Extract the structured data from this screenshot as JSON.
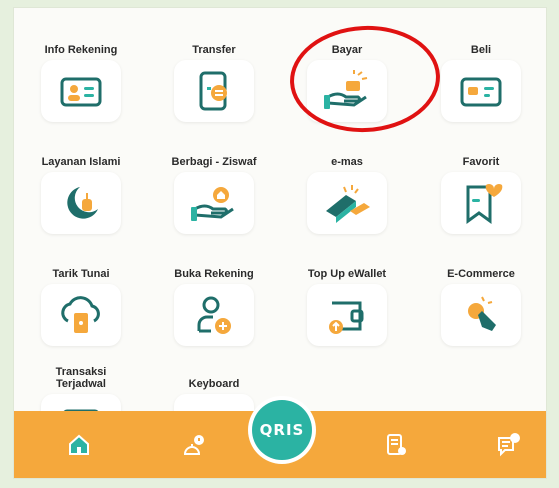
{
  "menu": [
    {
      "label": "Info Rekening",
      "icon": "id-card-icon"
    },
    {
      "label": "Transfer",
      "icon": "phone-transfer-icon"
    },
    {
      "label": "Bayar",
      "icon": "hand-pay-icon"
    },
    {
      "label": "Beli",
      "icon": "card-buy-icon"
    },
    {
      "label": "Layanan Islami",
      "icon": "moon-mosque-icon"
    },
    {
      "label": "Berbagi - Ziswaf",
      "icon": "hand-give-icon"
    },
    {
      "label": "e-mas",
      "icon": "gold-bar-icon"
    },
    {
      "label": "Favorit",
      "icon": "bookmark-heart-icon"
    },
    {
      "label": "Tarik Tunai",
      "icon": "cloud-cash-icon"
    },
    {
      "label": "Buka Rekening",
      "icon": "add-user-icon"
    },
    {
      "label": "Top Up eWallet",
      "icon": "wallet-topup-icon"
    },
    {
      "label": "E-Commerce",
      "icon": "tap-shop-icon"
    },
    {
      "label": "Transaksi\nTerjadwal",
      "icon": "calendar-icon"
    },
    {
      "label": "Keyboard",
      "icon": "keyboard-icon"
    }
  ],
  "bottom_nav": {
    "qris_label": "QRIS",
    "items": [
      "home-icon",
      "bell-notification-icon",
      "qris-icon",
      "bill-location-icon",
      "chat-help-icon"
    ]
  },
  "colors": {
    "accent": "#2bb3a3",
    "dark_teal": "#1f6e6a",
    "orange": "#f5a83c",
    "highlight": "#e01212"
  }
}
